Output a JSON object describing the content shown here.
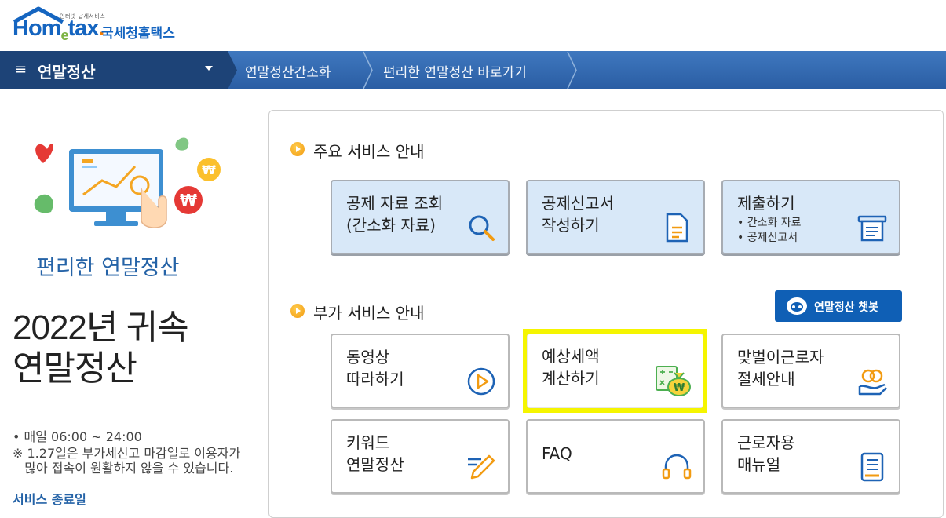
{
  "header": {
    "logo_sub": "인터넷 납세서비스",
    "logo_word_1": "Hom",
    "logo_word_e": "e",
    "logo_word_2": "tax",
    "logo_dot": ".",
    "logo_ko": "국세청홈택스"
  },
  "nav": {
    "menu_icon": "≡",
    "menu_title": "연말정산",
    "links": [
      "연말정산간소화",
      "편리한 연말정산 바로가기"
    ]
  },
  "left": {
    "subtitle": "편리한 연말정산",
    "title_line1": "2022년 귀속",
    "title_line2": "연말정산",
    "hours": "• 매일 06:00  ~ 24:00",
    "notice_line1": "※ 1.27일은 부가세신고 마감일로 이용자가",
    "notice_line2": "   많아 접속이 원활하지 않을 수 있습니다.",
    "service_end": "서비스 종료일"
  },
  "main_services": {
    "title": "주요 서비스 안내",
    "cards": [
      {
        "line1": "공제 자료 조회",
        "line2": "(간소화 자료)",
        "icon": "search-icon"
      },
      {
        "line1": "공제신고서",
        "line2": "작성하기",
        "icon": "document-icon"
      },
      {
        "line1": "제출하기",
        "bullets": [
          "• 간소화 자료",
          "• 공제신고서"
        ],
        "icon": "submit-icon"
      }
    ]
  },
  "extra_services": {
    "title": "부가 서비스 안내",
    "chatbot_label": "연말정산 챗봇",
    "cards": [
      {
        "line1": "동영상",
        "line2": "따라하기",
        "icon": "play-icon"
      },
      {
        "line1": "예상세액",
        "line2": "계산하기",
        "icon": "calculator-money-icon"
      },
      {
        "line1": "맞벌이근로자",
        "line2": "절세안내",
        "icon": "couple-hand-icon"
      },
      {
        "line1": "키워드",
        "line2": "연말정산",
        "icon": "pencil-icon"
      },
      {
        "line1": "FAQ",
        "icon": "headset-icon"
      },
      {
        "line1": "근로자용",
        "line2": "매뉴얼",
        "icon": "manual-icon"
      }
    ]
  },
  "colors": {
    "brand_blue": "#1565c0",
    "nav_dark": "#1d4377",
    "nav_bar": "#2f66ab",
    "highlight": "#f5f500",
    "accent_orange": "#f29b11"
  }
}
